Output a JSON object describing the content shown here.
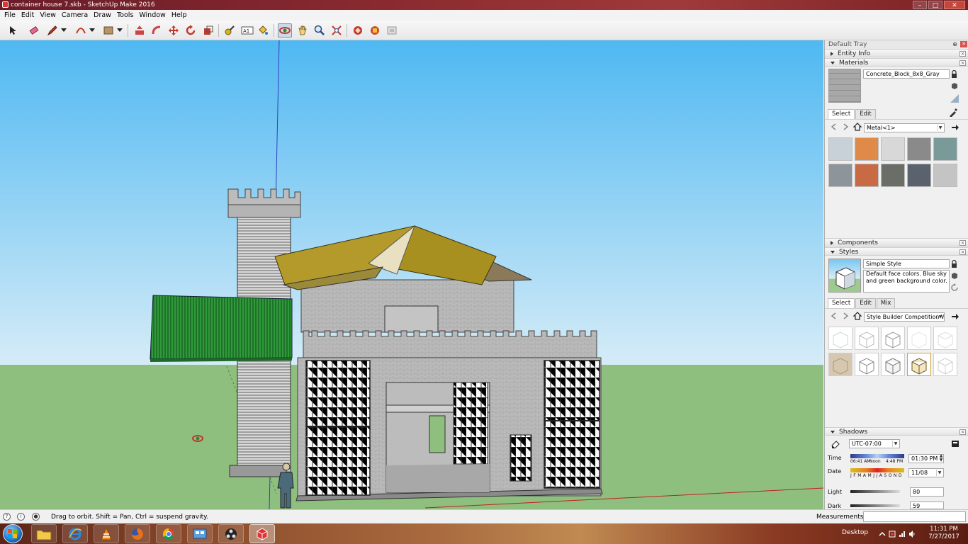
{
  "window": {
    "title": "container house 7.skb - SketchUp Make 2016",
    "controls": {
      "minimize": "–",
      "maximize": "□",
      "close": "✕"
    }
  },
  "menu": [
    "File",
    "Edit",
    "View",
    "Camera",
    "Draw",
    "Tools",
    "Window",
    "Help"
  ],
  "toolbar": {
    "tools": [
      "select-icon",
      "eraser-icon",
      "pencil-icon",
      "arc-icon",
      "rectangle-icon",
      "push-pull-icon",
      "follow-me-icon",
      "move-icon",
      "rotate-icon",
      "scale-icon",
      "tape-measure-icon",
      "text-icon",
      "paint-bucket-icon",
      "orbit-icon",
      "pan-icon",
      "zoom-icon",
      "zoom-extents-icon",
      "3d-warehouse-icon",
      "extension-warehouse-icon",
      "layout-icon"
    ],
    "text_tool_label": "A1",
    "active_tool": "orbit-icon"
  },
  "tray": {
    "title": "Default Tray",
    "pin_glyph": "⊕",
    "close_glyph": "✕",
    "panel_close_glyph": "×",
    "entity_info": {
      "label": "Entity Info"
    },
    "materials": {
      "label": "Materials",
      "current_material": "Concrete_Block_8x8_Gray",
      "tabs": [
        "Select",
        "Edit"
      ],
      "library": "Metal<1>",
      "swatch_colors": [
        "#c8d0d8",
        "#e08a4a",
        "#d8d8d8",
        "#8a8a8a",
        "#7a9a9a",
        "#8e959a",
        "#c86a44",
        "#6a6e66",
        "#5a626e",
        "#c4c4c4"
      ]
    },
    "components": {
      "label": "Components"
    },
    "styles": {
      "label": "Styles",
      "current_style": "Simple Style",
      "description": "Default face colors. Blue sky and green background color.",
      "tabs": [
        "Select",
        "Edit",
        "Mix"
      ],
      "library": "Style Builder Competition Wi"
    },
    "shadows": {
      "label": "Shadows",
      "timezone": "UTC-07:00",
      "time_label": "Time",
      "time_marks": [
        "06:41 AM",
        "Noon",
        "4:48 PM"
      ],
      "time_value": "01:30 PM",
      "date_label": "Date",
      "months": "J F M A M J J A S O N D",
      "date_value": "11/08",
      "light_label": "Light",
      "light_value": "80",
      "dark_label": "Dark",
      "dark_value": "59"
    }
  },
  "status": {
    "hint": "Drag to orbit. Shift = Pan, Ctrl = suspend gravity.",
    "measurements_label": "Measurements",
    "measurements_value": ""
  },
  "taskbar": {
    "apps": [
      "file-explorer-icon",
      "internet-explorer-icon",
      "vlc-icon",
      "firefox-icon",
      "chrome-icon",
      "control-panel-icon",
      "obs-icon",
      "sketchup-icon"
    ],
    "active_app": "sketchup-icon",
    "desktop_label": "Desktop",
    "time": "11:31 PM",
    "date": "7/27/2017"
  },
  "colors": {
    "sky_top": "#4fb8f2",
    "sky_bottom": "#d6ecf7",
    "ground": "#8fbf7f",
    "concrete": "#b8b8b8",
    "roof": "#b39a2a",
    "container_green": "#2f9a3a"
  }
}
